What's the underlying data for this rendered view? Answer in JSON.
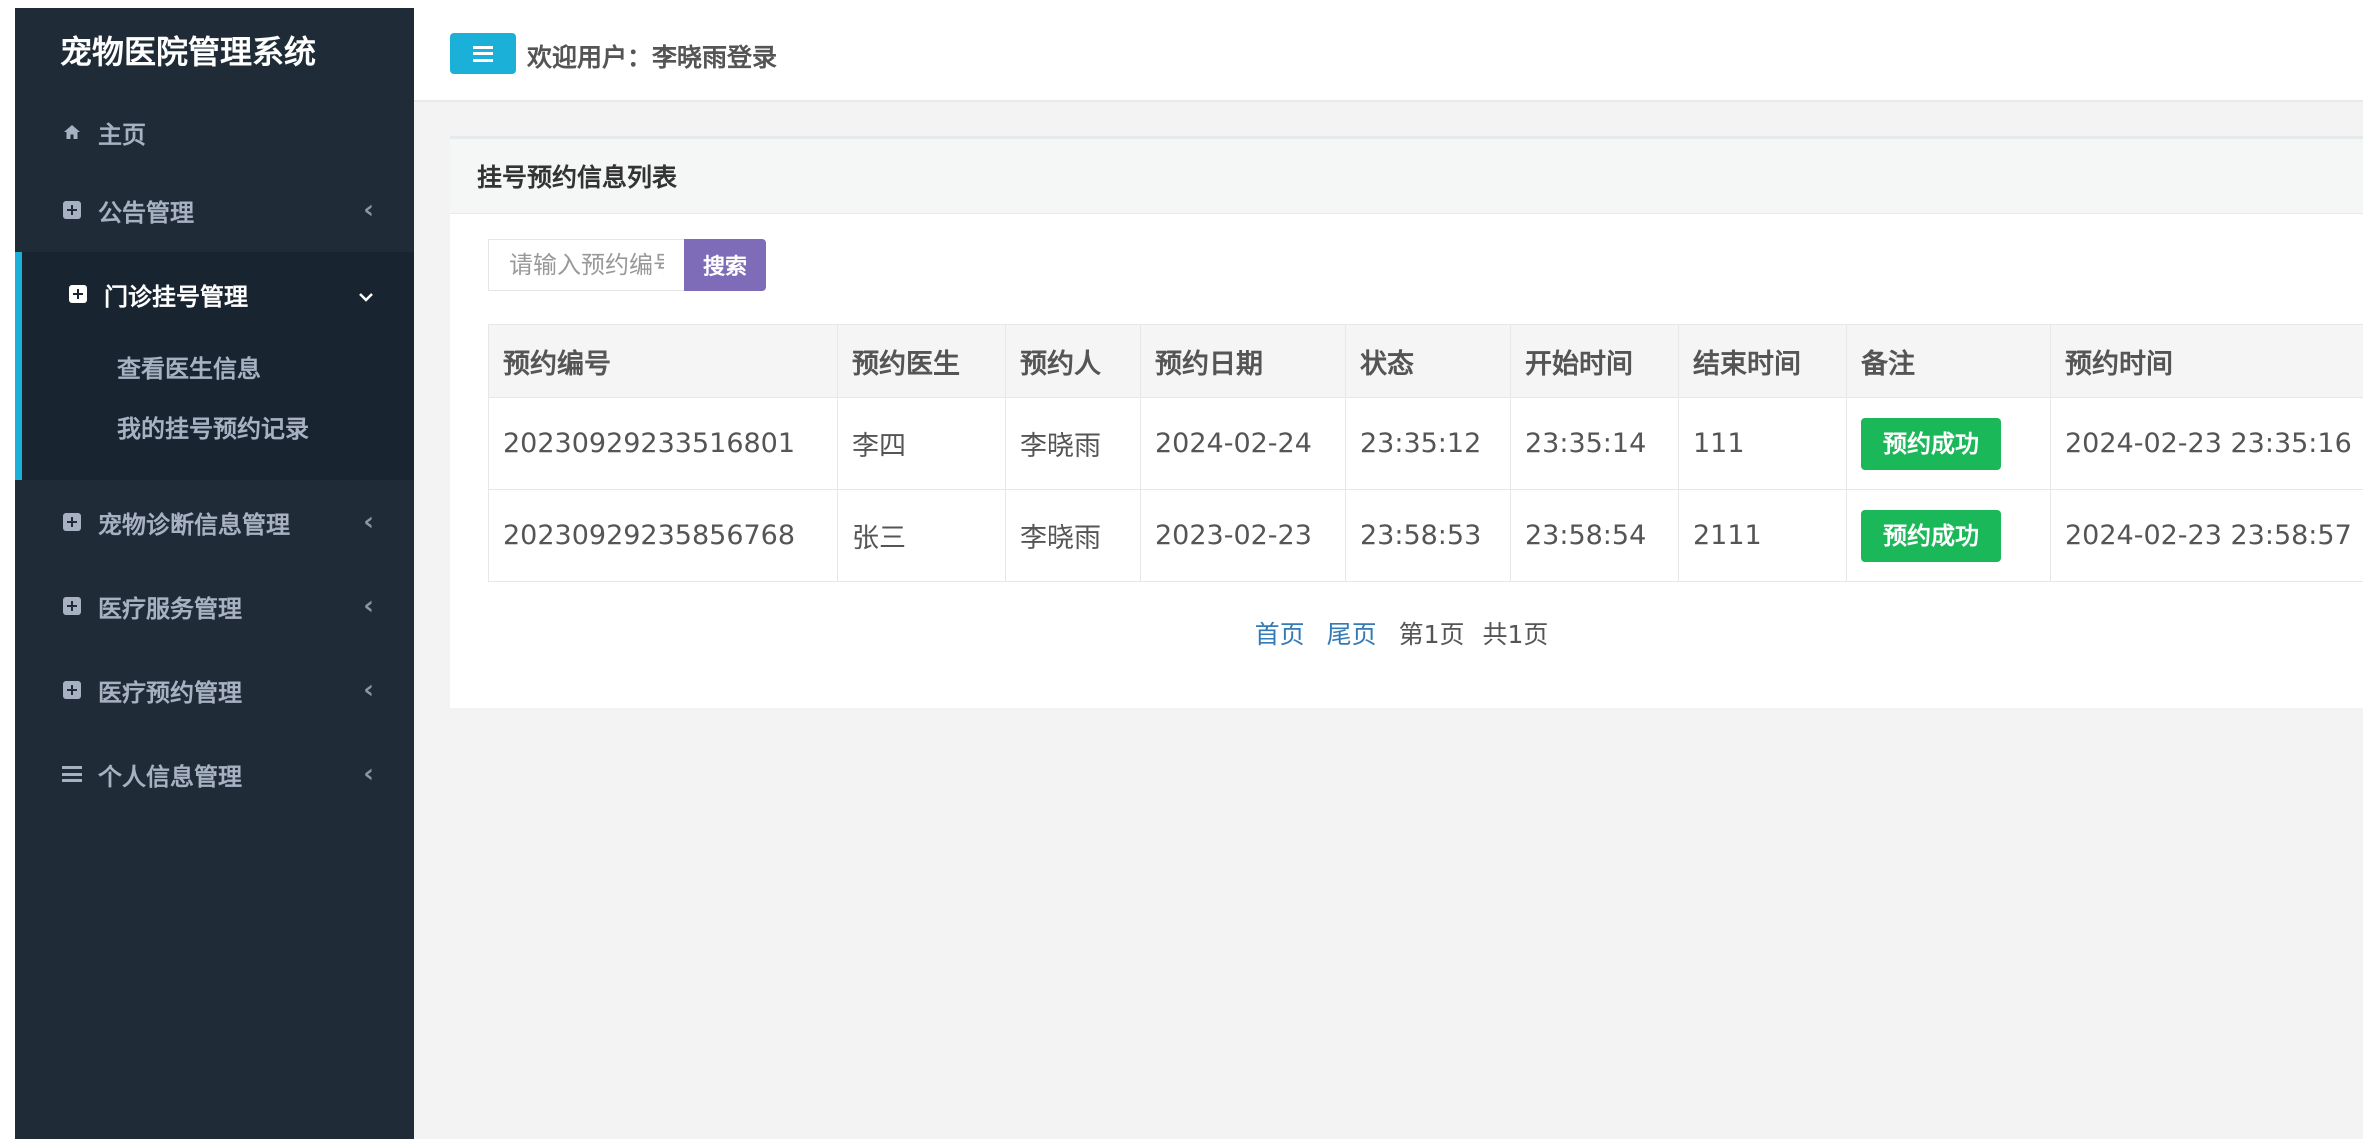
{
  "app": {
    "title": "宠物医院管理系统"
  },
  "sidebar": {
    "items": [
      {
        "label": "主页",
        "icon": "home-icon"
      },
      {
        "label": "公告管理",
        "icon": "plus-square-icon"
      },
      {
        "label": "门诊挂号管理",
        "icon": "plus-square-icon",
        "expanded": true,
        "children": [
          {
            "label": "查看医生信息"
          },
          {
            "label": "我的挂号预约记录"
          }
        ]
      },
      {
        "label": "宠物诊断信息管理",
        "icon": "plus-square-icon"
      },
      {
        "label": "医疗服务管理",
        "icon": "plus-square-icon"
      },
      {
        "label": "医疗预约管理",
        "icon": "plus-square-icon"
      },
      {
        "label": "个人信息管理",
        "icon": "bars-icon"
      }
    ]
  },
  "header": {
    "welcome": "欢迎用户：李晓雨登录"
  },
  "panel": {
    "title": "挂号预约信息列表",
    "search": {
      "placeholder": "请输入预约编号",
      "button_label": "搜索"
    },
    "table": {
      "columns": [
        "预约编号",
        "预约医生",
        "预约人",
        "预约日期",
        "状态",
        "开始时间",
        "结束时间",
        "备注",
        "预约时间"
      ],
      "rows": [
        [
          "20230929233516801",
          "李四",
          "李晓雨",
          "2024-02-24",
          "23:35:12",
          "23:35:14",
          "111",
          "预约成功",
          "2024-02-23 23:35:16"
        ],
        [
          "20230929235856768",
          "张三",
          "李晓雨",
          "2023-02-23",
          "23:58:53",
          "23:58:54",
          "2111",
          "预约成功",
          "2024-02-23 23:58:57"
        ]
      ]
    },
    "pagination": {
      "first": "首页",
      "last": "尾页",
      "current": "第1页",
      "total": "共1页"
    }
  },
  "colors": {
    "sidebar_bg": "#1f2c37",
    "accent": "#1ab0d8",
    "search_button": "#7e6cb8",
    "success": "#1bb85a"
  }
}
